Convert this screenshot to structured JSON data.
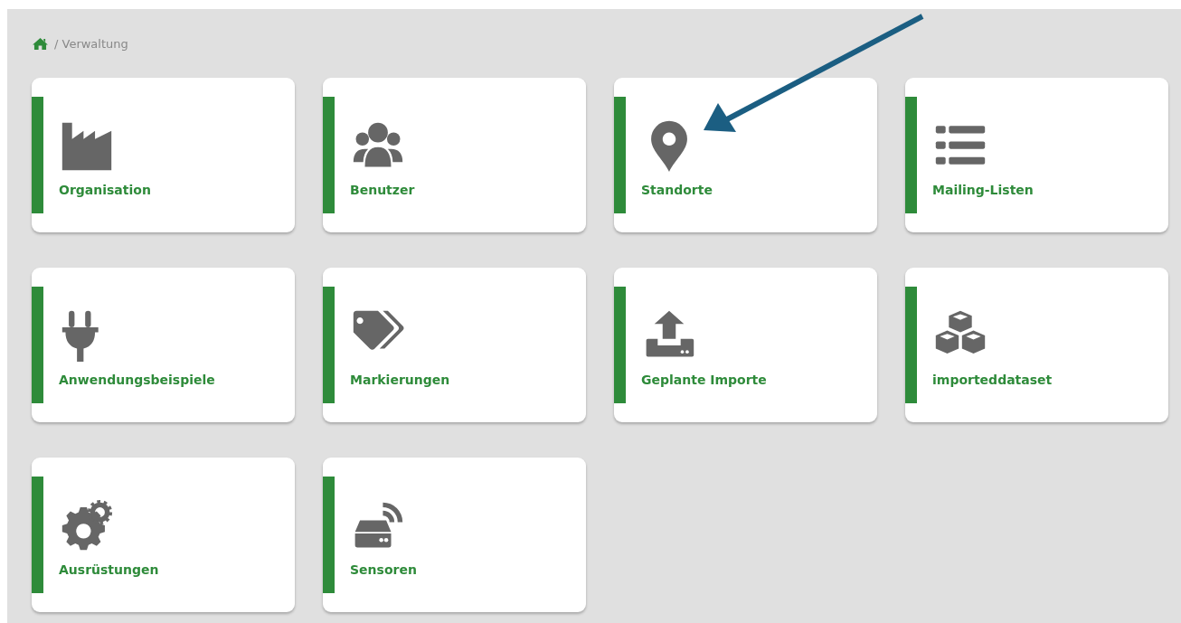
{
  "breadcrumb": {
    "path": "/ Verwaltung"
  },
  "tiles": [
    {
      "label": "Organisation",
      "kind": "factory"
    },
    {
      "label": "Benutzer",
      "kind": "users"
    },
    {
      "label": "Standorte",
      "kind": "marker"
    },
    {
      "label": "Mailing-Listen",
      "kind": "list"
    },
    {
      "label": "Anwendungsbeispiele",
      "kind": "plug"
    },
    {
      "label": "Markierungen",
      "kind": "tags"
    },
    {
      "label": "Geplante Importe",
      "kind": "upload"
    },
    {
      "label": "importeddataset",
      "kind": "cubes"
    },
    {
      "label": "Ausrüstungen",
      "kind": "gears"
    },
    {
      "label": "Sensoren",
      "kind": "router"
    }
  ]
}
